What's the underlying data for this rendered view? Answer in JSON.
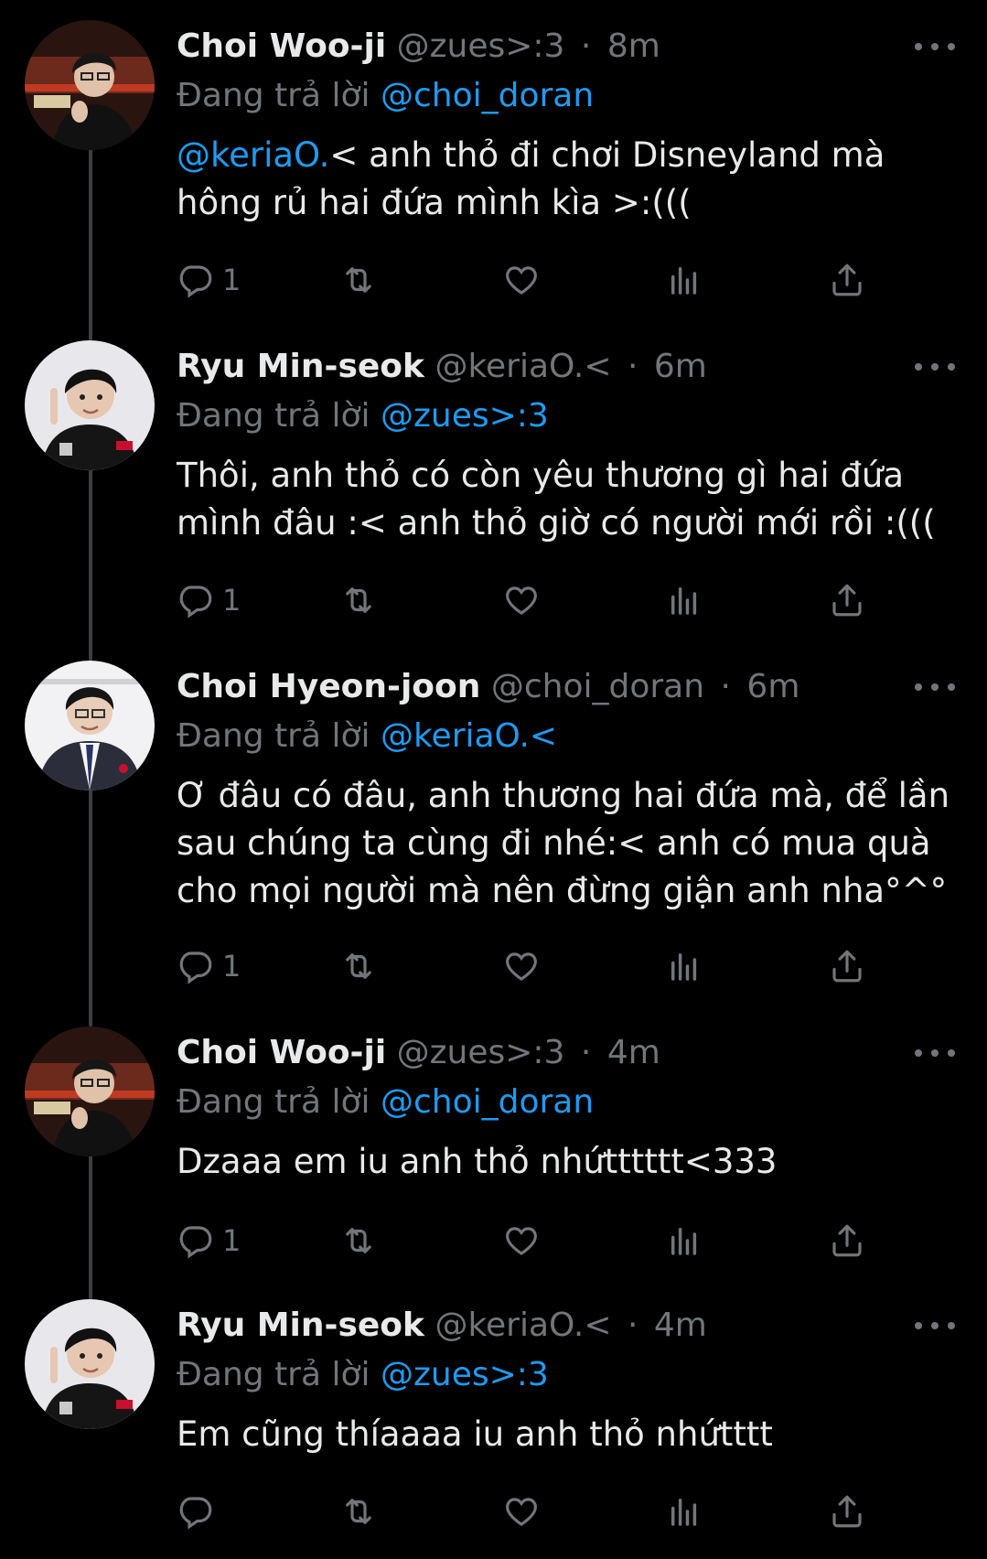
{
  "tweets": [
    {
      "name": "Choi Woo-ji",
      "handle": "@zues>:3",
      "separator": "·",
      "time": "8m",
      "replying_prefix": "Đang trả lời",
      "replying_to": "@choi_doran",
      "mention": "@keriaO.",
      "text": "< anh thỏ đi chơi Disneyland mà hông rủ hai đứa mình kìa >:(((",
      "reply_count": "1",
      "avatar": "zues-avatar"
    },
    {
      "name": "Ryu Min-seok",
      "handle": "@keriaO.<",
      "separator": "·",
      "time": "6m",
      "replying_prefix": "Đang trả lời",
      "replying_to": "@zues>:3",
      "mention": "",
      "text": "Thôi, anh thỏ có còn yêu thương gì hai đứa mình đâu :< anh thỏ giờ có người mới rồi :(((",
      "reply_count": "1",
      "avatar": "keria-avatar"
    },
    {
      "name": "Choi Hyeon-joon",
      "handle": "@choi_doran",
      "separator": "·",
      "time": "6m",
      "replying_prefix": "Đang trả lời",
      "replying_to": "@keriaO.<",
      "mention": "",
      "text": "Ơ đâu có đâu, anh thương hai đứa mà, để lần sau chúng ta cùng đi nhé:< anh có mua quà cho mọi người mà nên đừng giận anh nha°^°",
      "reply_count": "1",
      "avatar": "doran-avatar"
    },
    {
      "name": "Choi Woo-ji",
      "handle": "@zues>:3",
      "separator": "·",
      "time": "4m",
      "replying_prefix": "Đang trả lời",
      "replying_to": "@choi_doran",
      "mention": "",
      "text": "Dzaaa em iu anh thỏ nhứtttttt<333",
      "reply_count": "1",
      "avatar": "zues-avatar"
    },
    {
      "name": "Ryu Min-seok",
      "handle": "@keriaO.<",
      "separator": "·",
      "time": "4m",
      "replying_prefix": "Đang trả lời",
      "replying_to": "@zues>:3",
      "mention": "",
      "text": "Em cũng thíaaaa iu anh thỏ nhứtttt",
      "reply_count": "",
      "avatar": "keria-avatar"
    }
  ],
  "icons": [
    "reply-icon",
    "retweet-icon",
    "like-icon",
    "views-icon",
    "share-icon",
    "more-icon"
  ],
  "colors": {
    "background": "#000000",
    "text": "#e7e9ea",
    "secondary": "#71767b",
    "mention": "#1d9bf0",
    "thread_line": "#3a3f44"
  }
}
